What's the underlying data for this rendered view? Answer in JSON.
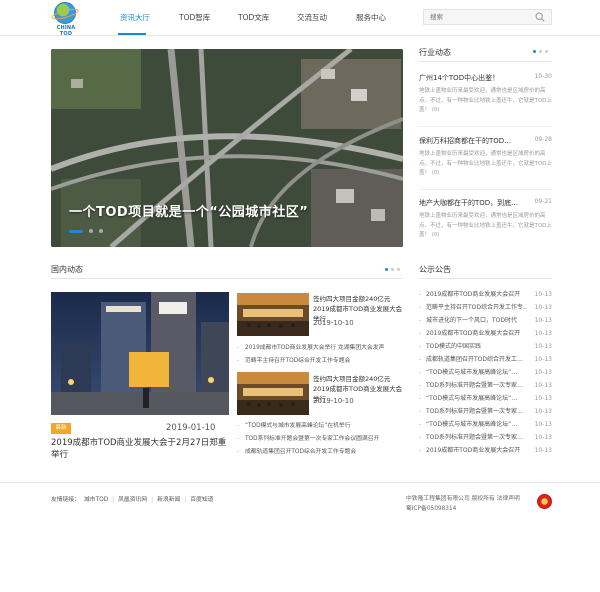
{
  "logo": {
    "text": "CHINA TOD"
  },
  "nav": [
    "资讯大厅",
    "TOD智库",
    "TOD文库",
    "交流互动",
    "服务中心"
  ],
  "search": {
    "placeholder": "搜索"
  },
  "hero": {
    "caption": "一个TOD项目就是一个“公园城市社区”"
  },
  "industry": {
    "title": "行业动态",
    "items": [
      {
        "title": "广州14个TOD中心出鉴！",
        "date": "10-30",
        "desc": "地铁上盖物业历来最受欢迎，通常也是区域房价的高点。不过，有一种物业比地铁上盖还牛，它就是TOD上盖！ (0)"
      },
      {
        "title": "保利万科招商都在干的TOD…",
        "date": "09-28",
        "desc": "地铁上盖物业历来最受欢迎，通常也是区域房价的高点。不过，有一种物业比地铁上盖还牛，它就是TOD上盖！ (0)"
      },
      {
        "title": "地产大咖都在干的TOD，到底…",
        "date": "09-21",
        "desc": "地铁上盖物业历来最受欢迎，通常也是区域房价的高点。不过，有一种物业比地铁上盖还牛，它就是TOD上盖！ (0)"
      }
    ]
  },
  "domestic": {
    "title": "国内动态",
    "badge": "最新",
    "big_date": "2019-01-10",
    "big_title": "2019成都市TOD商业发展大会于2月27日郑重举行",
    "thumbs": [
      {
        "title": "签约四大项目金额240亿元 2019成都市TOD商业发展大会举行",
        "date": "2019-10-10"
      },
      {
        "title": "签约四大项目金额240亿元 2019成都市TOD商业发展大会举行",
        "date": "2019-10-10"
      }
    ],
    "list1": [
      "2019成都市TOD商业发展大会举行 龙湖集团大会发声",
      "范畴平主持召开TOD综合开发工作专题会"
    ],
    "list2": [
      "“TOD模式与城市发展高峰论坛”在机举行",
      "TOD系列标准开题会暨第一次专家工作会议圆满召开",
      "成都轨道集团召开TOD综合开发工作专题会"
    ]
  },
  "notices": {
    "title": "公示公告",
    "items": [
      {
        "t": "2019成都市TOD商业发展大会召开",
        "d": "10-13"
      },
      {
        "t": "范畴平主持召开TOD综合开发工作专…",
        "d": "10-13"
      },
      {
        "t": "城市进化的下一个风口，TOD时代",
        "d": "10-13"
      },
      {
        "t": "2019成都市TOD商业发展大会召开",
        "d": "10-13"
      },
      {
        "t": "TOD模式的中国实践",
        "d": "10-13"
      },
      {
        "t": "成都轨道集团召开TOD综合开发工…",
        "d": "10-13"
      },
      {
        "t": "“TOD模式与城市发展高峰论坛”…",
        "d": "10-13"
      },
      {
        "t": "TOD系列标准开题会暨第一次专家…",
        "d": "10-13"
      },
      {
        "t": "“TOD模式与城市发展高峰论坛”…",
        "d": "10-13"
      },
      {
        "t": "TOD系列标准开题会暨第一次专家…",
        "d": "10-13"
      },
      {
        "t": "“TOD模式与城市发展高峰论坛”…",
        "d": "10-13"
      },
      {
        "t": "TOD系列标准开题会暨第一次专家…",
        "d": "10-13"
      },
      {
        "t": "2019成都市TOD商业发展大会召开",
        "d": "10-13"
      }
    ]
  },
  "footer": {
    "links_label": "友情链接：",
    "links": [
      "城市TOD",
      "凤凰资讯网",
      "新浪新闻",
      "百度知道"
    ],
    "copyright": "中铁隆工程集团有限公司 版权所有 法律声明",
    "icp": "蜀ICP备05098314"
  },
  "colors": {
    "accent": "#1a8ad8",
    "badge": "#f5a623"
  }
}
